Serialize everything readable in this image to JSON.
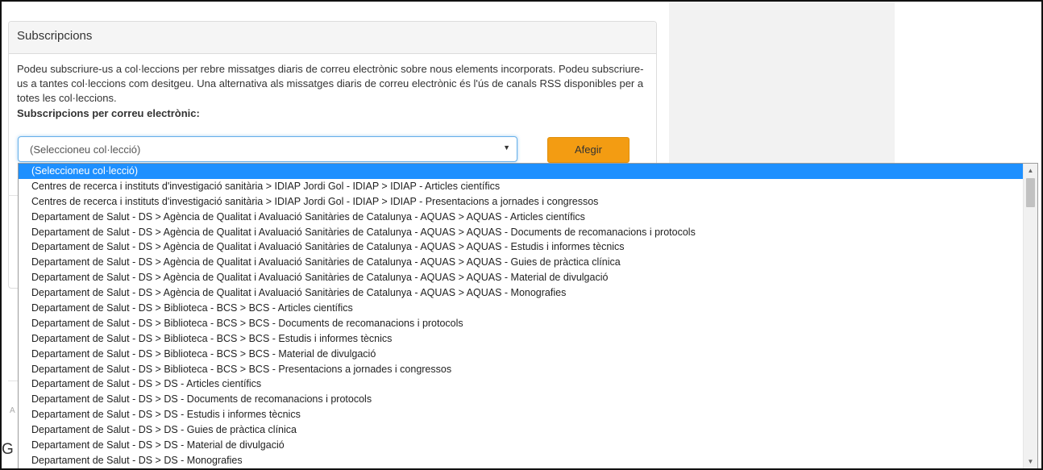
{
  "panel": {
    "title": "Subscripcions",
    "description": "Podeu subscriure-us a col·leccions per rebre missatges diaris de correu electrònic sobre nous elements incorporats. Podeu subscriure-us a tantes col·leccions com desitgeu. Una alternativa als missatges diaris de correu electrònic és l'ús de canals RSS disponibles per a totes les col·leccions.",
    "email_label": "Subscripcions per correu electrònic:"
  },
  "select": {
    "value": "(Seleccioneu col·lecció)"
  },
  "add_button": "Afegir",
  "stray": {
    "g": "G",
    "a": "A"
  },
  "dropdown": {
    "options": [
      "(Seleccioneu col·lecció)",
      "Centres de recerca i instituts d'investigació sanitària > IDIAP Jordi Gol - IDIAP > IDIAP - Articles científics",
      "Centres de recerca i instituts d'investigació sanitària > IDIAP Jordi Gol - IDIAP > IDIAP - Presentacions a jornades i congressos",
      "Departament de Salut - DS > Agència de Qualitat i Avaluació Sanitàries de Catalunya - AQUAS > AQUAS - Articles científics",
      "Departament de Salut - DS > Agència de Qualitat i Avaluació Sanitàries de Catalunya - AQUAS > AQUAS - Documents de recomanacions i protocols",
      "Departament de Salut - DS > Agència de Qualitat i Avaluació Sanitàries de Catalunya - AQUAS > AQUAS - Estudis i informes tècnics",
      "Departament de Salut - DS > Agència de Qualitat i Avaluació Sanitàries de Catalunya - AQUAS > AQUAS - Guies de pràctica clínica",
      "Departament de Salut - DS > Agència de Qualitat i Avaluació Sanitàries de Catalunya - AQUAS > AQUAS - Material de divulgació",
      "Departament de Salut - DS > Agència de Qualitat i Avaluació Sanitàries de Catalunya - AQUAS > AQUAS - Monografies",
      "Departament de Salut - DS > Biblioteca - BCS > BCS - Articles científics",
      "Departament de Salut - DS > Biblioteca - BCS > BCS - Documents de recomanacions i protocols",
      "Departament de Salut - DS > Biblioteca - BCS > BCS - Estudis i informes tècnics",
      "Departament de Salut - DS > Biblioteca - BCS > BCS - Material de divulgació",
      "Departament de Salut - DS > Biblioteca - BCS > BCS - Presentacions a jornades i congressos",
      "Departament de Salut - DS > DS - Articles científics",
      "Departament de Salut - DS > DS - Documents de recomanacions i protocols",
      "Departament de Salut - DS > DS - Estudis i informes tècnics",
      "Departament de Salut - DS > DS - Guies de pràctica clínica",
      "Departament de Salut - DS > DS - Material de divulgació",
      "Departament de Salut - DS > DS - Monografies"
    ],
    "selected_index": 0
  },
  "colors": {
    "selected_option_bg": "#1e90ff",
    "add_button_bg": "#f39c12",
    "focus_border": "#66afe9"
  }
}
